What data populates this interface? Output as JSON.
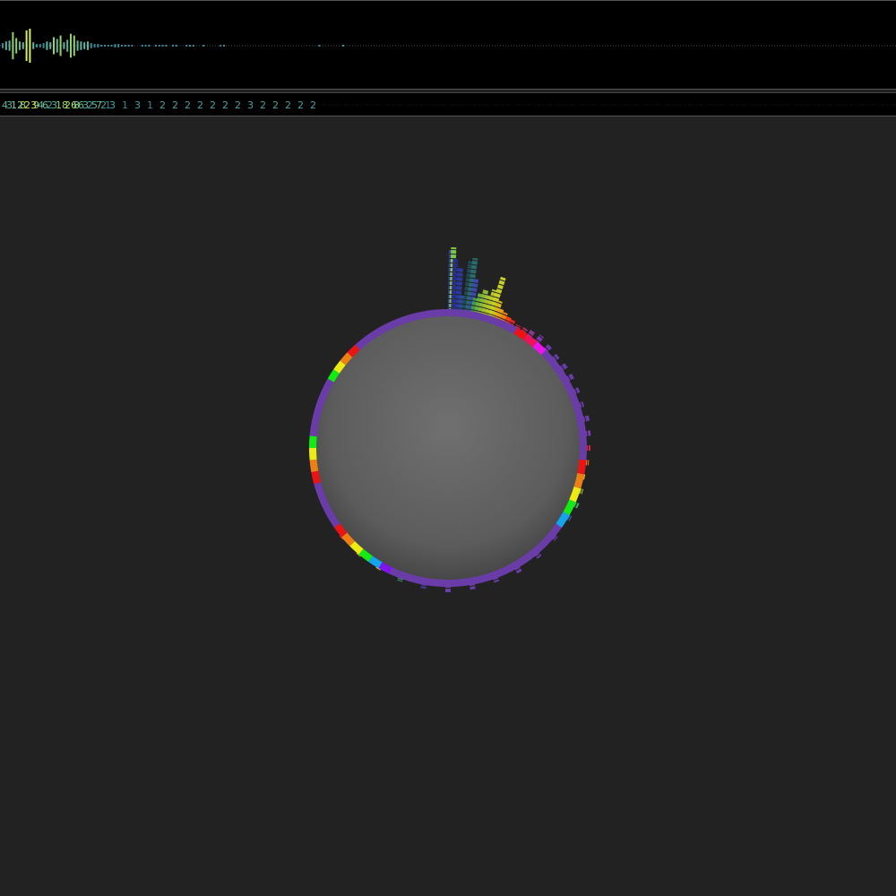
{
  "waveform": {
    "bars": [
      3,
      5,
      6,
      16,
      9,
      5,
      4,
      18,
      20,
      4,
      2,
      2,
      3,
      5,
      4,
      10,
      8,
      12,
      4,
      7,
      14,
      12,
      6,
      5,
      4,
      5,
      3,
      2,
      2,
      1,
      1,
      1,
      1,
      2,
      2,
      1,
      1,
      1,
      1,
      0,
      0,
      1,
      1,
      1,
      0,
      1,
      1,
      1,
      1,
      0,
      1,
      1,
      0,
      0,
      1,
      1,
      1,
      0,
      0,
      1,
      0,
      0,
      0,
      0,
      1,
      1,
      0,
      0,
      0,
      0,
      0,
      0,
      0,
      0,
      0,
      0,
      0,
      0,
      0,
      0,
      0,
      0,
      0,
      0,
      0,
      0,
      0,
      0,
      0,
      0,
      0,
      0,
      0,
      1,
      0,
      0,
      0,
      0,
      0,
      0,
      1,
      0,
      0,
      0,
      0,
      0,
      0,
      0,
      0,
      0,
      0,
      0,
      0,
      0,
      0,
      0,
      0,
      0,
      0,
      0,
      0,
      0,
      0,
      0,
      0,
      0,
      0,
      0,
      0,
      0,
      0,
      0,
      0,
      0,
      0,
      0,
      0,
      0,
      0,
      0,
      0,
      0,
      0,
      0,
      0,
      0,
      0,
      0,
      0,
      0,
      0,
      0,
      0,
      0,
      0,
      0,
      0,
      0,
      0,
      0,
      0,
      0,
      0,
      0,
      0,
      0,
      0,
      0,
      0,
      0,
      0,
      0,
      0,
      0,
      0,
      0,
      0,
      0,
      0,
      0,
      0,
      0,
      0,
      0,
      0,
      0,
      0,
      0,
      0,
      0,
      0,
      0,
      0,
      0,
      0,
      0,
      0,
      0,
      0,
      0,
      0,
      0,
      0,
      0,
      0,
      0,
      0,
      0,
      0,
      0,
      0,
      0,
      0,
      0,
      0,
      0,
      0,
      0,
      0,
      0,
      0,
      0,
      0,
      0,
      0,
      0,
      0,
      0,
      0,
      0,
      0,
      0,
      0,
      0,
      0,
      0,
      0,
      0,
      0,
      0,
      0,
      0,
      0,
      0,
      0,
      0,
      0,
      0,
      0,
      0,
      0
    ]
  },
  "counts": {
    "labels": [
      {
        "text": "4",
        "c": "#5fb3a0"
      },
      {
        "text": "3",
        "c": "#5fb3a0"
      },
      {
        "text": "12",
        "c": "#7fcf9a"
      },
      {
        "text": "8",
        "c": "#8fd36a"
      },
      {
        "text": "23",
        "c": "#c9e34a"
      },
      {
        "text": "9",
        "c": "#9fd65e"
      },
      {
        "text": "4",
        "c": "#5fb3a0"
      },
      {
        "text": "6",
        "c": "#6ac08a"
      },
      {
        "text": "2",
        "c": "#4aa0a0"
      },
      {
        "text": "3",
        "c": "#5fb3a0"
      },
      {
        "text": "18",
        "c": "#8fd36a"
      },
      {
        "text": "26",
        "c": "#b0dc55"
      },
      {
        "text": "8",
        "c": "#7fcf9a"
      },
      {
        "text": "6",
        "c": "#6ac08a"
      },
      {
        "text": "3",
        "c": "#5fb3a0"
      },
      {
        "text": "2",
        "c": "#4aa0a0"
      },
      {
        "text": "5",
        "c": "#5fb3a0"
      },
      {
        "text": "7",
        "c": "#6ac08a"
      },
      {
        "text": "2",
        "c": "#4aa0a0"
      },
      {
        "text": "1",
        "c": "#3a8a8a"
      },
      {
        "text": "3",
        "c": "#4aa0a0"
      },
      {
        "text": "1",
        "c": "#3a8a8a"
      },
      {
        "text": "3",
        "c": "#4aa0a0"
      },
      {
        "text": "1",
        "c": "#3a8a8a"
      },
      {
        "text": "2",
        "c": "#4aa0a0"
      },
      {
        "text": "2",
        "c": "#4aa0a0"
      },
      {
        "text": "2",
        "c": "#4aa0a0"
      },
      {
        "text": "2",
        "c": "#4aa0a0"
      },
      {
        "text": "2",
        "c": "#4aa0a0"
      },
      {
        "text": "2",
        "c": "#4aa0a0"
      },
      {
        "text": "2",
        "c": "#4aa0a0"
      },
      {
        "text": "3",
        "c": "#4aa0a0"
      },
      {
        "text": "2",
        "c": "#4aa0a0"
      },
      {
        "text": "2",
        "c": "#4aa0a0"
      },
      {
        "text": "2",
        "c": "#4aa0a0"
      },
      {
        "text": "2",
        "c": "#4aa0a0"
      },
      {
        "text": "2",
        "c": "#4aa0a0"
      }
    ]
  },
  "palette": {
    "background": "#222222",
    "strip": "#000000",
    "sphere_center": "#6e6e6e",
    "sphere_edge": "#3c3c3c",
    "ring_base": "#6a3ca8"
  }
}
